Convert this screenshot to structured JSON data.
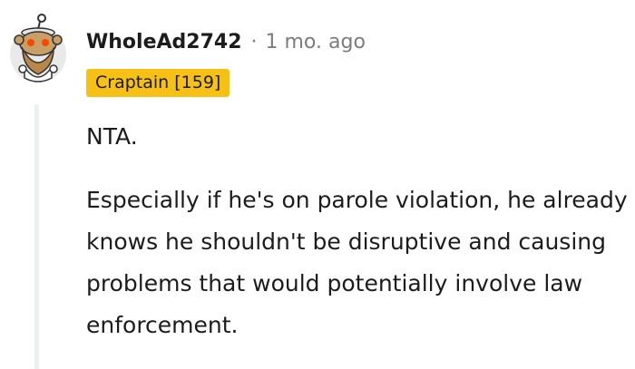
{
  "comment": {
    "username": "WholeAd2742",
    "separator": "·",
    "time": "1 mo. ago",
    "flair": "Craptain [159]",
    "paragraphs": [
      "NTA.",
      "Especially if he's on parole violation, he already knows he shouldn't be disruptive and causing problems that would potentially involve law enforcement."
    ]
  },
  "colors": {
    "flair_background": "#f6c015",
    "username_text": "#1c1c1c",
    "meta_text": "#7c7c7c",
    "thread_line": "#edeff1",
    "snoo_eyes": "#ff4500"
  },
  "avatar": {
    "icon": "snoo-avatar-icon"
  }
}
